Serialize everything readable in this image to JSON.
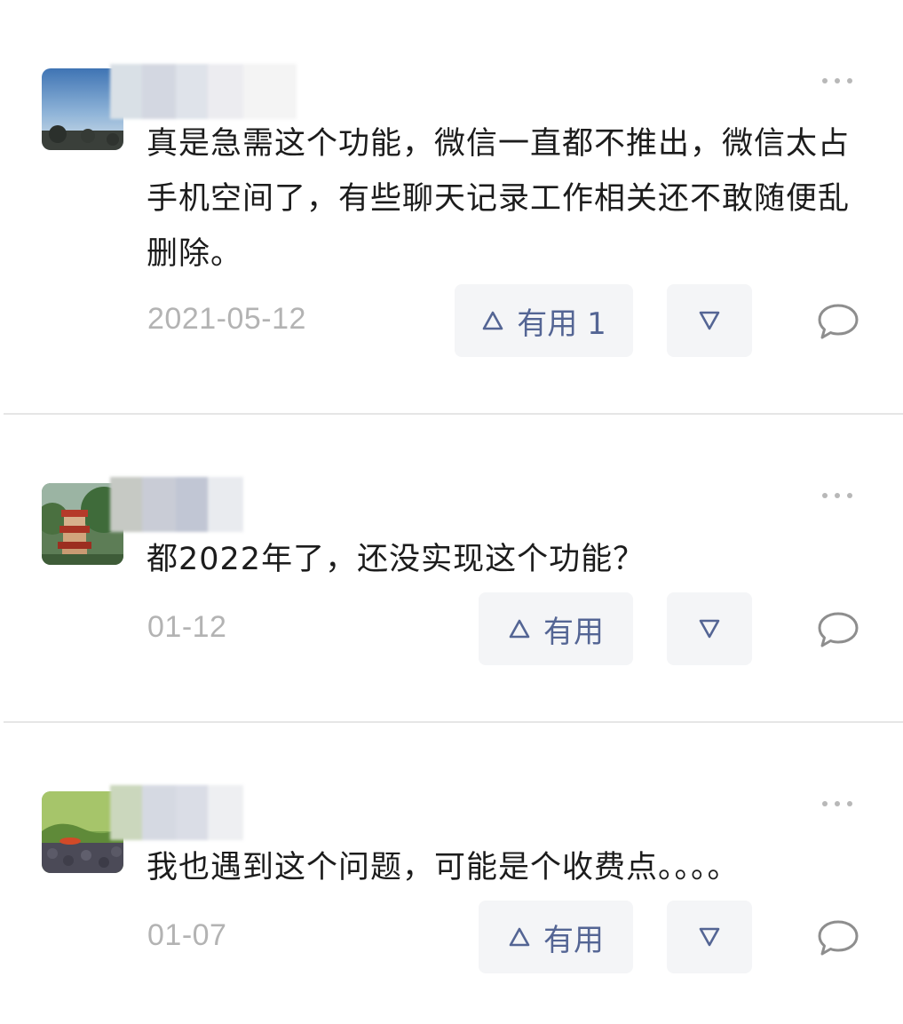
{
  "comments": [
    {
      "text": "真是急需这个功能，微信一直都不推出，微信太占手机空间了，有些聊天记录工作相关还不敢随便乱删除。",
      "date": "2021-05-12",
      "useful_label": "有用 1"
    },
    {
      "text": "都2022年了，还没实现这个功能？",
      "date": "01-12",
      "useful_label": "有用"
    },
    {
      "text": "我也遇到这个问题，可能是个收费点。。。。",
      "date": "01-07",
      "useful_label": "有用"
    }
  ],
  "icons": {
    "upvote": "triangle-up-icon",
    "downvote": "triangle-down-icon",
    "reply": "comment-bubble-icon",
    "more": "more-dots-icon"
  },
  "colors": {
    "accent": "#546594",
    "button_bg": "#f4f5f7",
    "date": "#b3b3b3",
    "divider": "#e6e6e6"
  }
}
